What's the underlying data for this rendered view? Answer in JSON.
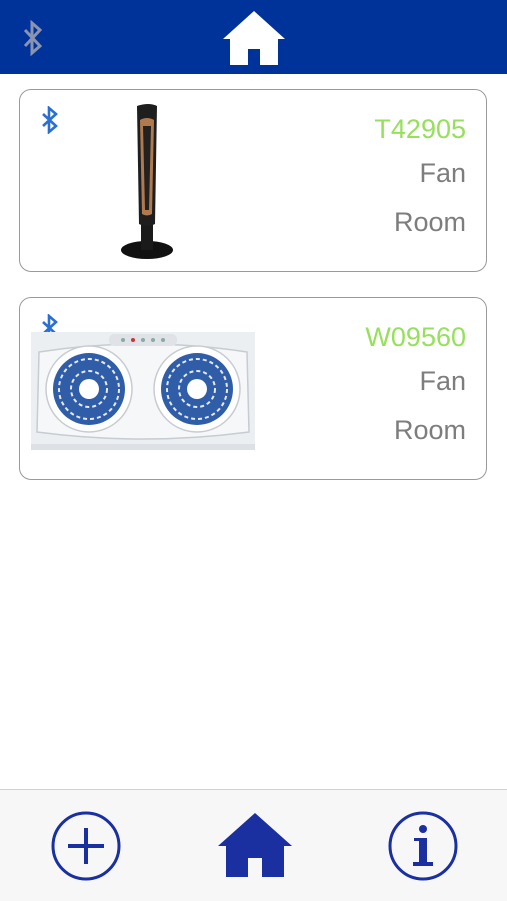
{
  "header": {
    "bluetooth_icon": "bluetooth-icon",
    "home_icon": "home-icon",
    "background_color": "#003399"
  },
  "devices": [
    {
      "model": "T42905",
      "type": "Fan",
      "location": "Room",
      "image": "tower-fan-image",
      "connection_icon": "bluetooth-icon"
    },
    {
      "model": "W09560",
      "type": "Fan",
      "location": "Room",
      "image": "window-fan-image",
      "connection_icon": "bluetooth-icon"
    }
  ],
  "tabbar": {
    "add_icon": "plus-circle-icon",
    "home_icon": "home-icon",
    "info_icon": "info-circle-icon",
    "accent_color": "#1a2fa0"
  },
  "colors": {
    "model_text": "#96e05b",
    "secondary_text": "#7d7d7d",
    "card_border": "#9a9a9a"
  }
}
